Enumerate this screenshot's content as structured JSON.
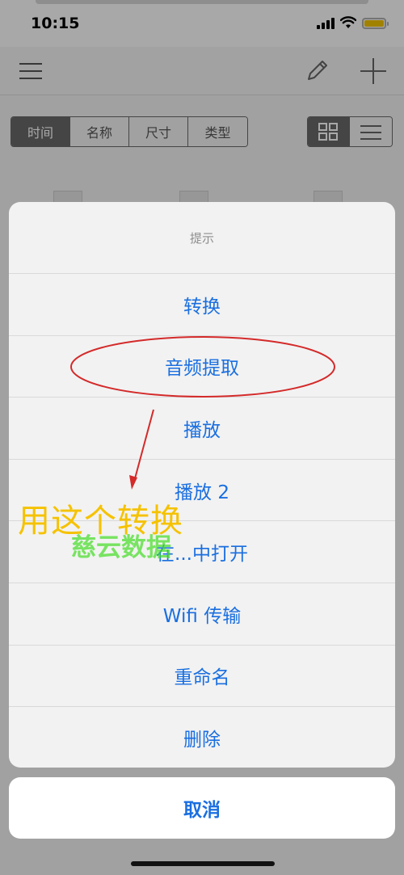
{
  "status_bar": {
    "time": "10:15"
  },
  "toolbar": {
    "sort_tabs": [
      {
        "label": "时间",
        "active": true
      },
      {
        "label": "名称",
        "active": false
      },
      {
        "label": "尺寸",
        "active": false
      },
      {
        "label": "类型",
        "active": false
      }
    ],
    "view_mode": "grid"
  },
  "action_sheet": {
    "title": "提示",
    "actions": [
      {
        "label": "转换"
      },
      {
        "label": "音频提取"
      },
      {
        "label": "播放"
      },
      {
        "label": "播放 2"
      },
      {
        "label": "在...中打开"
      },
      {
        "label": "Wifi 传输"
      },
      {
        "label": "重命名"
      },
      {
        "label": "删除"
      }
    ],
    "cancel_label": "取消"
  },
  "annotations": {
    "callout_text": "用这个转换",
    "watermark": "慈云数据"
  },
  "colors": {
    "action_blue": "#1a6fe0",
    "annotation_red": "#d42a2a",
    "callout_yellow": "#f5c200",
    "watermark_green": "#46dc28",
    "battery_yellow": "#f5c400"
  },
  "icons": [
    "menu-icon",
    "pencil-icon",
    "plus-icon",
    "grid-view-icon",
    "list-view-icon",
    "signal-icon",
    "wifi-icon",
    "battery-icon"
  ]
}
